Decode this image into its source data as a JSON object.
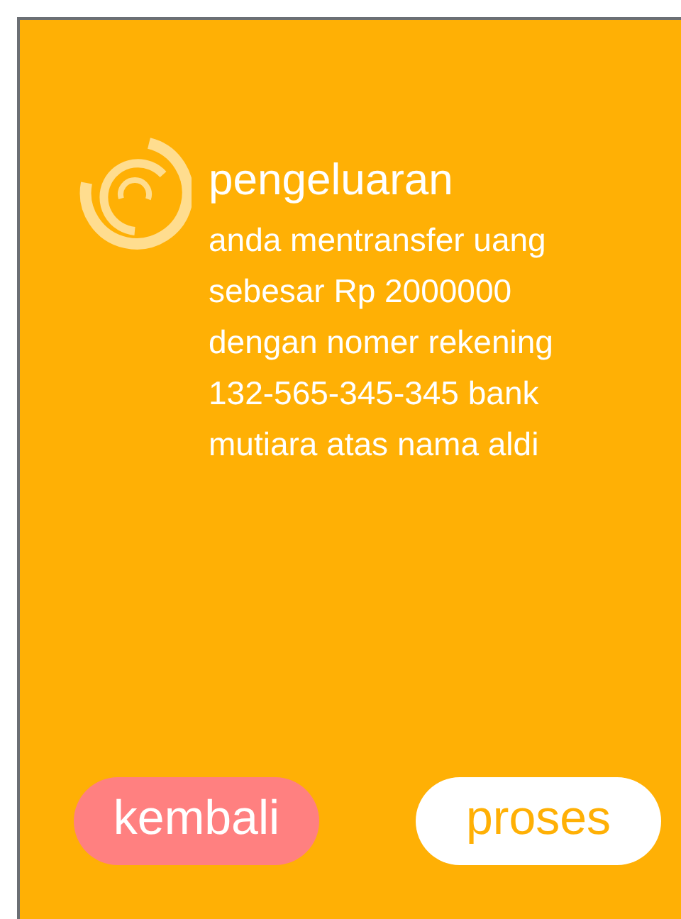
{
  "title": "pengeluaran",
  "message": "anda mentransfer uang sebesar Rp 2000000 dengan nomer rekening 132-565-345-345 bank mutiara atas nama aldi",
  "buttons": [
    {
      "label": "kembali",
      "kind": "cancel"
    },
    {
      "label": "proses",
      "kind": "confirm"
    }
  ]
}
